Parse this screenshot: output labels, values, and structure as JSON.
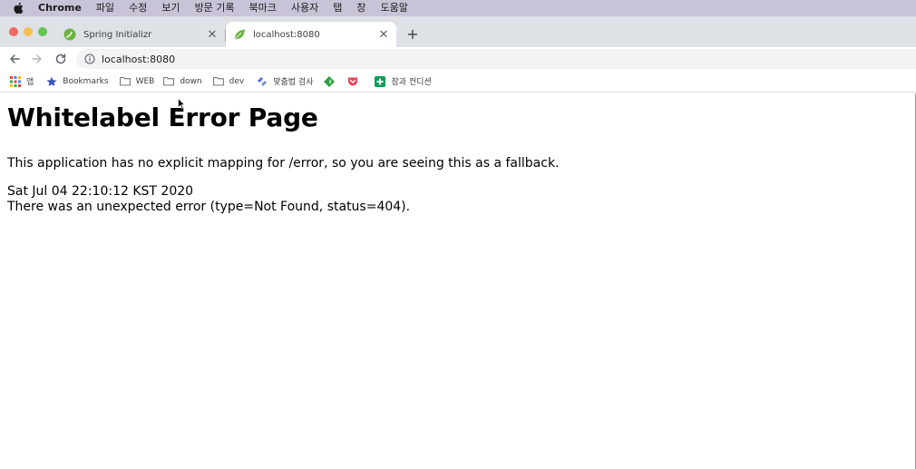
{
  "menubar": {
    "app_name": "Chrome",
    "items": [
      "파일",
      "수정",
      "보기",
      "방문 기록",
      "북마크",
      "사용자",
      "탭",
      "창",
      "도움말"
    ]
  },
  "tabs": [
    {
      "title": "Spring Initializr",
      "active": false,
      "favicon": "spring-icon"
    },
    {
      "title": "localhost:8080",
      "active": true,
      "favicon": "spring-leaf-icon"
    }
  ],
  "toolbar": {
    "url": "localhost:8080"
  },
  "bookmarks": {
    "items": [
      {
        "label": "앱",
        "icon": "apps-grid-icon"
      },
      {
        "label": "Bookmarks",
        "icon": "star-icon"
      },
      {
        "label": "WEB",
        "icon": "folder-icon"
      },
      {
        "label": "down",
        "icon": "folder-icon"
      },
      {
        "label": "dev",
        "icon": "folder-icon"
      },
      {
        "label": "맞춤법 검사",
        "icon": "spellcheck-icon"
      },
      {
        "label": "",
        "icon": "green-diamond-icon"
      },
      {
        "label": "",
        "icon": "pocket-icon"
      },
      {
        "label": "잠과 컨디션",
        "icon": "green-plus-icon"
      }
    ]
  },
  "page": {
    "title": "Whitelabel Error Page",
    "message": "This application has no explicit mapping for /error, so you are seeing this as a fallback.",
    "timestamp": "Sat Jul 04 22:10:12 KST 2020",
    "error": "There was an unexpected error (type=Not Found, status=404)."
  },
  "colors": {
    "menubar_bg": "#c9c3d8",
    "tabstrip_bg": "#dee1e6",
    "spring_green": "#6db33f",
    "close_red": "#ed6a5e",
    "minimize_yellow": "#f5bf4f",
    "zoom_green": "#62c554"
  }
}
